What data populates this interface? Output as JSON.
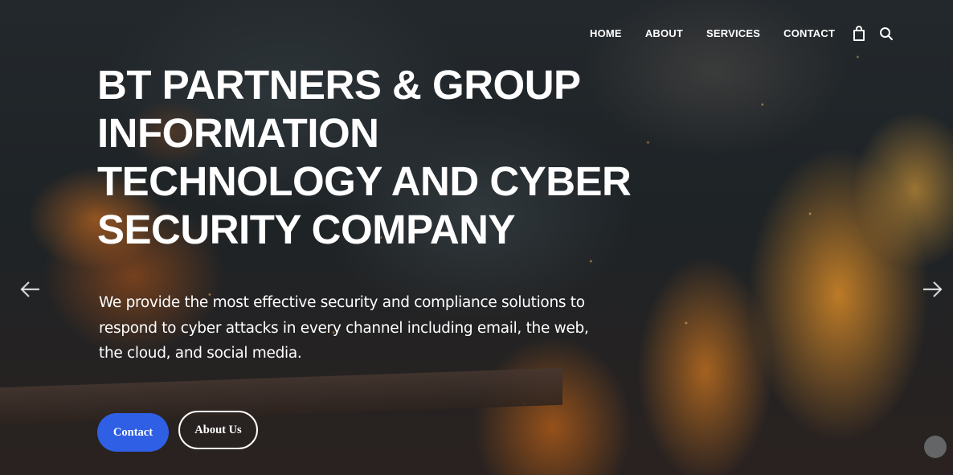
{
  "nav": {
    "items": [
      {
        "label": "HOME"
      },
      {
        "label": "ABOUT"
      },
      {
        "label": "SERVICES"
      },
      {
        "label": "CONTACT"
      }
    ],
    "icons": [
      "shopping-bag-icon",
      "search-icon"
    ]
  },
  "hero": {
    "headline_lines": [
      "BT PARTNERS & GROUP",
      "INFORMATION",
      "TECHNOLOGY AND CYBER",
      "SECURITY COMPANY"
    ],
    "lead_lines": [
      "We provide the most effective security and compliance solutions to",
      "respond to cyber attacks in every channel including email, the web,",
      "the cloud, and social media."
    ],
    "primary_button": "Contact",
    "secondary_button": "About Us",
    "prev_icon": "arrow-left-icon",
    "next_icon": "arrow-right-icon"
  },
  "colors": {
    "primary_button": "#2f5fe4",
    "text": "#ffffff"
  }
}
